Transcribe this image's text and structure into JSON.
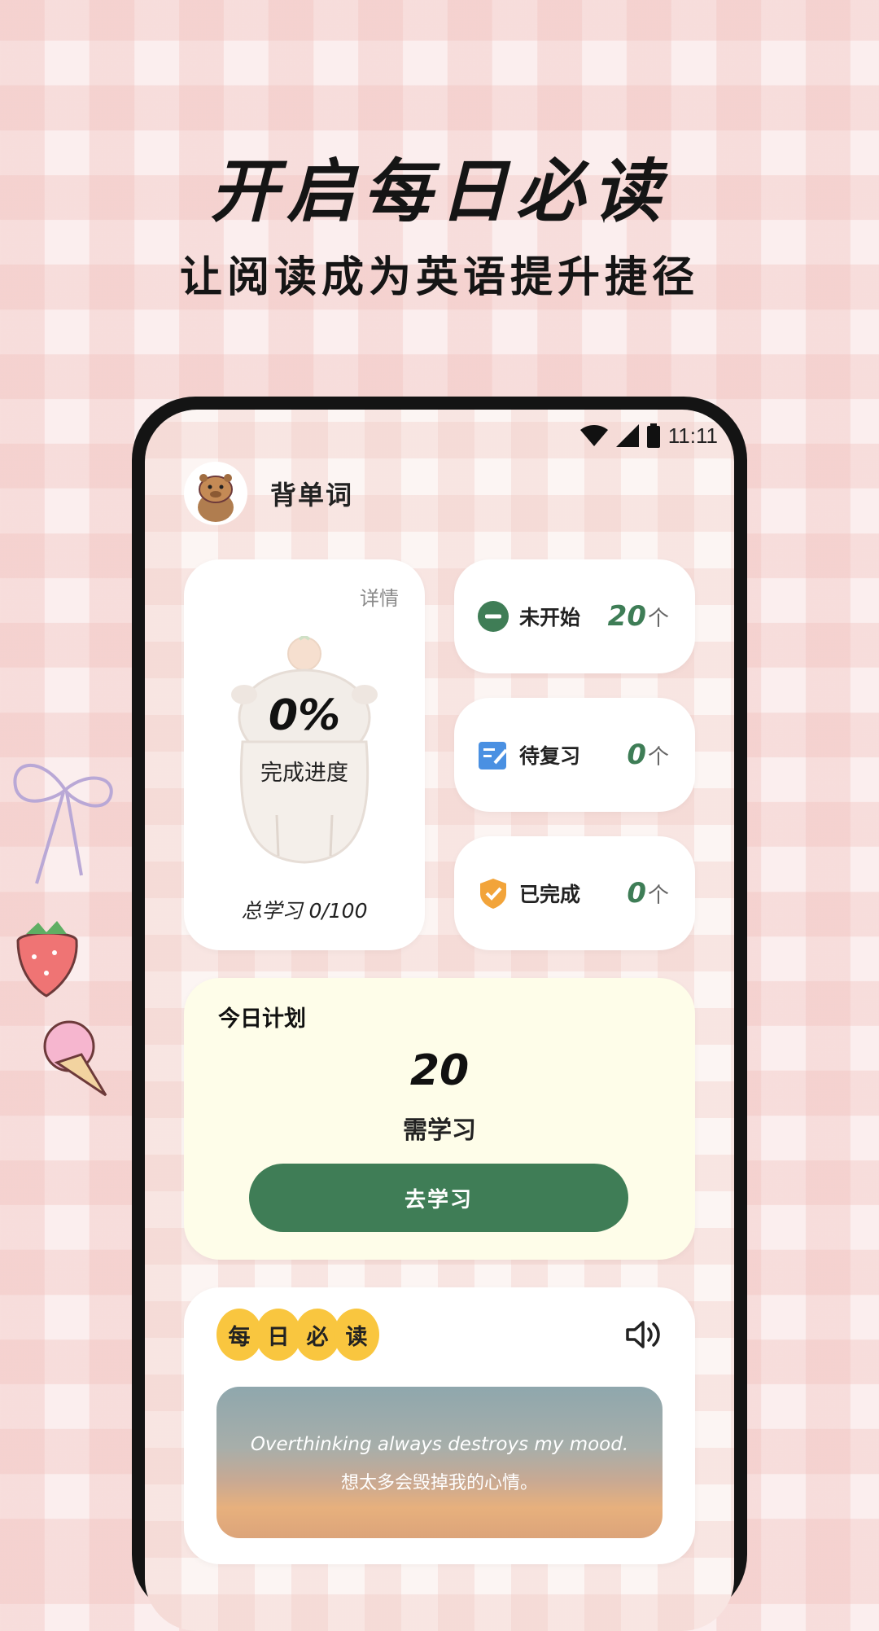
{
  "promo": {
    "title": "开启每日必读",
    "subtitle": "让阅读成为英语提升捷径"
  },
  "status_bar": {
    "time": "11:11",
    "icons": [
      "wifi-icon",
      "signal-icon",
      "battery-icon"
    ]
  },
  "header": {
    "title": "背单词",
    "avatar_icon": "capybara-avatar"
  },
  "progress": {
    "details_label": "详情",
    "percent": "0%",
    "percent_label": "完成进度",
    "total_label": "总学习 0/100"
  },
  "stats": [
    {
      "label": "未开始",
      "value": "20",
      "unit": "个",
      "icon": "minus-circle-icon"
    },
    {
      "label": "待复习",
      "value": "0",
      "unit": "个",
      "icon": "edit-note-icon"
    },
    {
      "label": "已完成",
      "value": "0",
      "unit": "个",
      "icon": "shield-check-icon"
    }
  ],
  "plan": {
    "title": "今日计划",
    "number": "20",
    "label": "需学习",
    "button": "去学习"
  },
  "daily": {
    "badge": [
      "每",
      "日",
      "必",
      "读"
    ],
    "speaker_icon": "speaker-icon",
    "quote_en": "Overthinking always destroys my mood.",
    "quote_zh": "想太多会毁掉我的心情。"
  },
  "colors": {
    "accent_green": "#3f7d56",
    "badge_yellow": "#f9c63f",
    "plan_bg": "#fefde9",
    "icon_orange": "#f2a43a",
    "icon_blue": "#4a90e2"
  }
}
